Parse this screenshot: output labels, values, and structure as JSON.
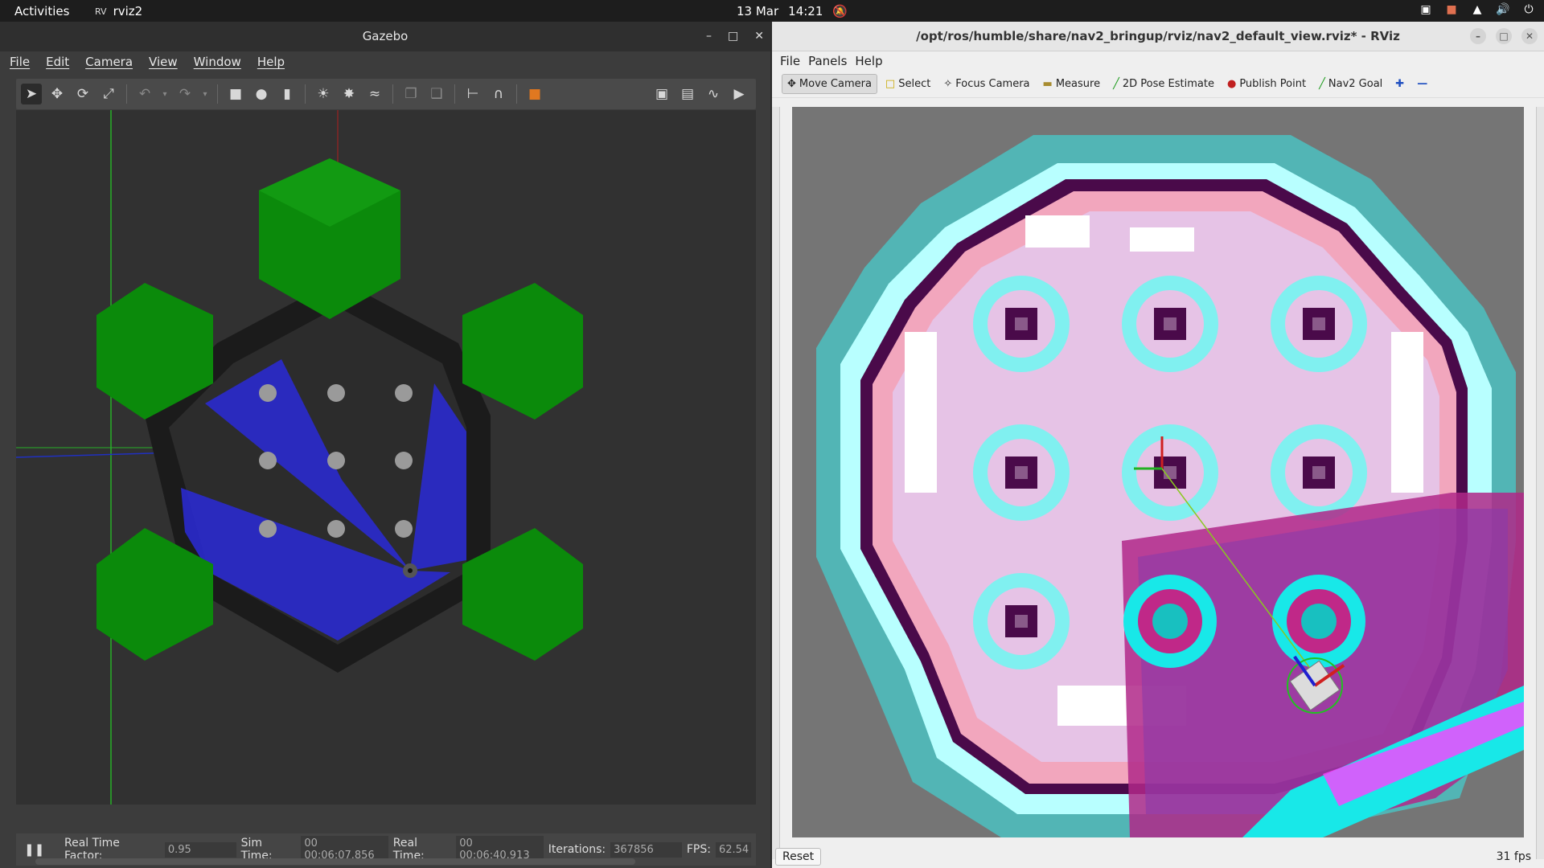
{
  "topbar": {
    "activities": "Activities",
    "app": "rviz2",
    "date": "13 Mar",
    "time": "14:21"
  },
  "gazebo": {
    "title": "Gazebo",
    "menu": [
      "File",
      "Edit",
      "Camera",
      "View",
      "Window",
      "Help"
    ],
    "status": {
      "rtf_label": "Real Time Factor:",
      "rtf_value": "0.95",
      "sim_label": "Sim Time:",
      "sim_value": "00 00:06:07.856",
      "real_label": "Real Time:",
      "real_value": "00 00:06:40.913",
      "iter_label": "Iterations:",
      "iter_value": "367856",
      "fps_label": "FPS:",
      "fps_value": "62.54"
    }
  },
  "rviz": {
    "title": "/opt/ros/humble/share/nav2_bringup/rviz/nav2_default_view.rviz* - RViz",
    "menu": [
      "File",
      "Panels",
      "Help"
    ],
    "tools": [
      "Move Camera",
      "Select",
      "Focus Camera",
      "Measure",
      "2D Pose Estimate",
      "Publish Point",
      "Nav2 Goal"
    ],
    "reset": "Reset",
    "fps": "31 fps"
  }
}
